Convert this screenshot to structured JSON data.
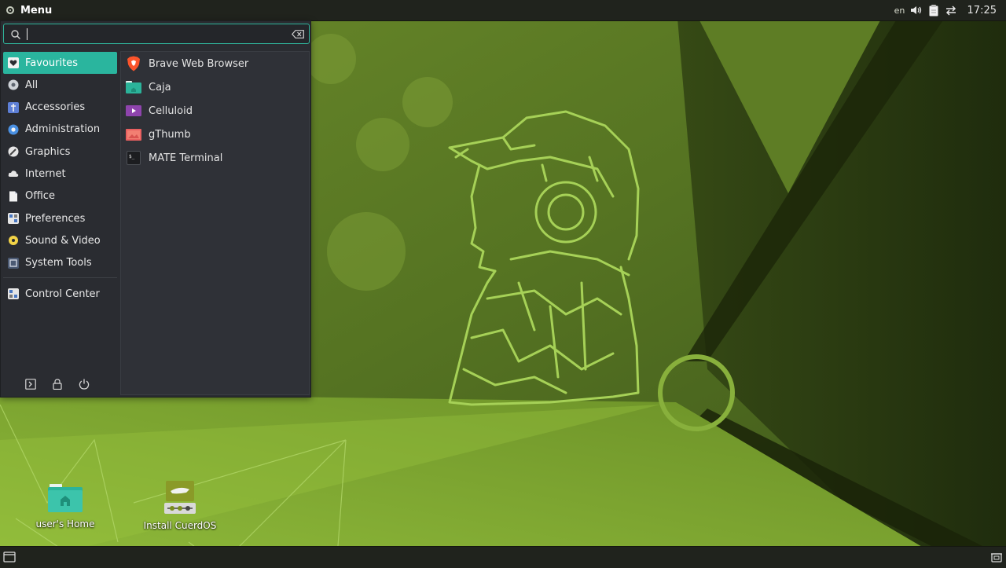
{
  "top_panel": {
    "menu_label": "Menu",
    "keyboard_layout": "en",
    "clock": "17:25"
  },
  "menu": {
    "search": {
      "value": "",
      "placeholder": ""
    },
    "categories": [
      {
        "label": "Favourites",
        "icon": "heart-icon",
        "active": true
      },
      {
        "label": "All",
        "icon": "all-apps-icon"
      },
      {
        "label": "Accessories",
        "icon": "accessories-icon"
      },
      {
        "label": "Administration",
        "icon": "administration-icon"
      },
      {
        "label": "Graphics",
        "icon": "graphics-icon"
      },
      {
        "label": "Internet",
        "icon": "internet-icon"
      },
      {
        "label": "Office",
        "icon": "office-icon"
      },
      {
        "label": "Preferences",
        "icon": "preferences-icon"
      },
      {
        "label": "Sound & Video",
        "icon": "sound-video-icon"
      },
      {
        "label": "System Tools",
        "icon": "system-tools-icon"
      }
    ],
    "control_center": {
      "label": "Control Center",
      "icon": "control-center-icon"
    },
    "session_buttons": [
      "logout-icon",
      "lock-icon",
      "power-icon"
    ],
    "apps": [
      {
        "label": "Brave Web Browser",
        "icon": "brave-icon"
      },
      {
        "label": "Caja",
        "icon": "caja-folder-icon"
      },
      {
        "label": "Celluloid",
        "icon": "celluloid-icon"
      },
      {
        "label": "gThumb",
        "icon": "gthumb-icon"
      },
      {
        "label": "MATE Terminal",
        "icon": "terminal-icon"
      }
    ]
  },
  "desktop": {
    "icons": [
      {
        "label": "user's Home",
        "icon": "home-folder-icon"
      },
      {
        "label": "Install CuerdOS",
        "icon": "installer-icon"
      }
    ]
  },
  "colors": {
    "accent": "#2ab59e",
    "panel": "#20231d",
    "menu_bg": "#2a2c31",
    "wallpaper_green": "#5a7a22",
    "line_art": "#a6d157"
  }
}
